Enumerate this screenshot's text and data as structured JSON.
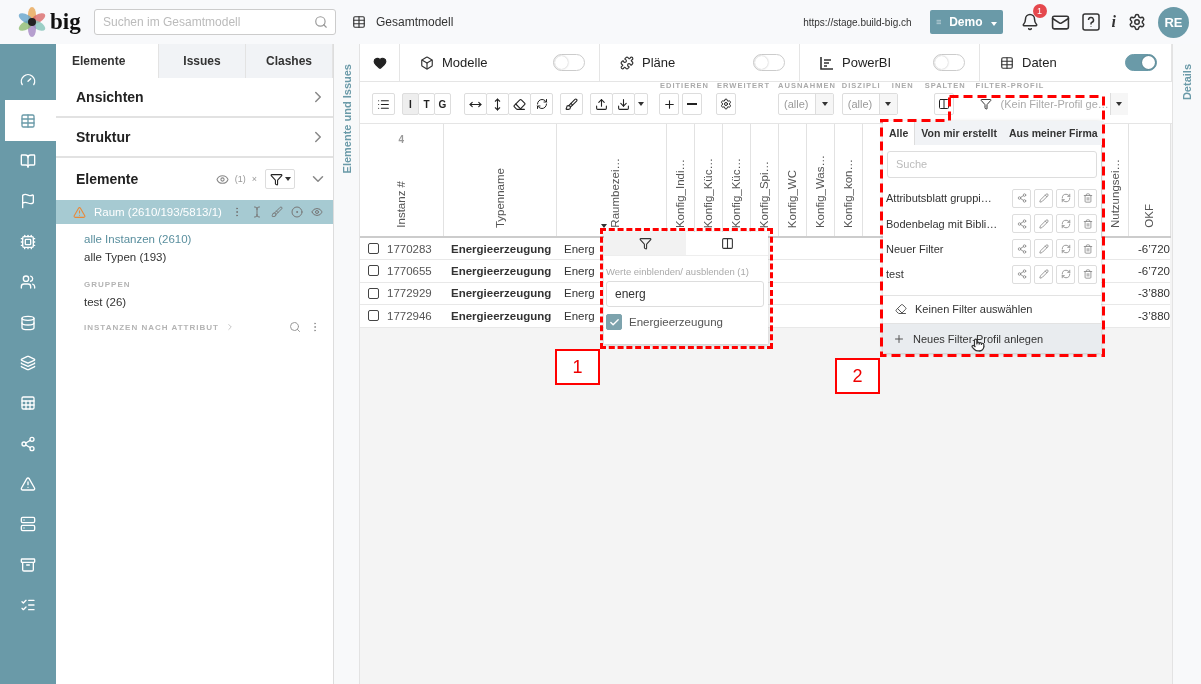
{
  "header": {
    "logo": "big",
    "search_placeholder": "Suchen im Gesamtmodell",
    "model": "Gesamtmodell",
    "url": "https://stage.build-big.ch",
    "workspace": "Demo",
    "notifications": "1",
    "info": "i",
    "avatar": "RE"
  },
  "rail": [
    {
      "selected": false
    },
    {
      "selected": true
    },
    {
      "selected": false
    },
    {
      "selected": false
    },
    {
      "selected": false
    },
    {
      "selected": false
    },
    {
      "selected": false
    },
    {
      "selected": false
    },
    {
      "selected": false
    },
    {
      "selected": false
    },
    {
      "selected": false
    },
    {
      "selected": false
    },
    {
      "selected": false
    },
    {
      "selected": false
    }
  ],
  "side_tabs": [
    {
      "label": "Elemente",
      "selected": true
    },
    {
      "label": "Issues",
      "selected": false
    },
    {
      "label": "Clashes",
      "selected": false
    }
  ],
  "sections": [
    {
      "title": "Ansichten",
      "expanded": false
    },
    {
      "title": "Struktur",
      "expanded": false
    }
  ],
  "elements": {
    "title": "Elemente",
    "count": "(1)",
    "clear": "×",
    "expanded": true,
    "items": [
      {
        "label": "Raum (2610/193/5813/1)",
        "selected": true,
        "warning": true
      }
    ],
    "links": [
      {
        "label": "alle Instanzen (2610)",
        "selected": true
      },
      {
        "label": "alle Typen (193)",
        "selected": false
      }
    ],
    "groups_label": "GRUPPEN",
    "groups": [
      "test (26)"
    ],
    "attribute_label": "INSTANZEN NACH ATTRIBUT"
  },
  "left_strip": "Elemente und Issues",
  "right_strip": "Details",
  "views": [
    {
      "label": "Modelle",
      "on": false
    },
    {
      "label": "Pläne",
      "on": false
    },
    {
      "label": "PowerBI",
      "on": false
    },
    {
      "label": "Daten",
      "on": true
    }
  ],
  "toolbar": {
    "modes": [
      {
        "label": "I",
        "selected": true
      },
      {
        "label": "T",
        "selected": false
      },
      {
        "label": "G",
        "selected": false
      }
    ],
    "edit_label": "EDITIEREN",
    "extended_label": "ERWEITERT",
    "exceptions": {
      "label": "AUSNAHMEN",
      "value": "(alle)"
    },
    "disciplines": {
      "label": "DISZIPLI",
      "value": "(alle)"
    },
    "columns_label_fragment": "INEN",
    "columns_label": "SPALTEN",
    "profile": {
      "label": "FILTER-PROFIL",
      "placeholder": "(Kein Filter-Profil ge…"
    }
  },
  "table": {
    "count": "4",
    "columns": [
      {
        "label": "Instanz #",
        "filtered": false
      },
      {
        "label": "Typenname",
        "filtered": false
      },
      {
        "label": "Raumbezei…",
        "filtered": true
      },
      {
        "label": "Konfig_Indi…",
        "filtered": false
      },
      {
        "label": "Konfig_Küc…",
        "filtered": false
      },
      {
        "label": "Konfig_Küc…",
        "filtered": false
      },
      {
        "label": "Konfig_Spi…",
        "filtered": false
      },
      {
        "label": "Konfig_WC",
        "filtered": false
      },
      {
        "label": "Konfig_Was…",
        "filtered": false
      },
      {
        "label": "Konfig_kon…",
        "filtered": false
      },
      {
        "label": "Nutzungsei…",
        "filtered": false
      },
      {
        "label": "OKF",
        "filtered": false
      }
    ],
    "rows": [
      {
        "checked": false,
        "id": "1770283",
        "type": "Energieerzeugung",
        "room": "Energ",
        "value": "-6’720"
      },
      {
        "checked": false,
        "id": "1770655",
        "type": "Energieerzeugung",
        "room": "Energ",
        "value": "-6’720"
      },
      {
        "checked": false,
        "id": "1772929",
        "type": "Energieerzeugung",
        "room": "Energ",
        "value": "-3’880"
      },
      {
        "checked": false,
        "id": "1772946",
        "type": "Energieerzeugung",
        "room": "Energ",
        "value": "-3’880"
      }
    ]
  },
  "filter_popup": {
    "tabs": [
      {
        "kind": "filter",
        "selected": true
      },
      {
        "kind": "columns",
        "selected": false
      }
    ],
    "label": "Werte einblenden/ ausblenden (1)",
    "value": "energ",
    "options": [
      {
        "label": "Energieerzeugung",
        "checked": true
      }
    ]
  },
  "profile_dropdown": {
    "tabs": [
      {
        "label": "Alle",
        "selected": true
      },
      {
        "label": "Von mir erstellt",
        "selected": false
      },
      {
        "label": "Aus meiner Firma",
        "selected": false
      }
    ],
    "search_placeholder": "Suche",
    "profiles": [
      {
        "label": "Attributsblatt gruppi…"
      },
      {
        "label": "Bodenbelag mit Bibli…"
      },
      {
        "label": "Neuer Filter"
      },
      {
        "label": "test"
      }
    ],
    "clear": "Keinen Filter auswählen",
    "create": {
      "label": "Neues Filter-Profil anlegen",
      "hovered": true
    }
  },
  "annotations": [
    {
      "label": "1"
    },
    {
      "label": "2"
    }
  ]
}
